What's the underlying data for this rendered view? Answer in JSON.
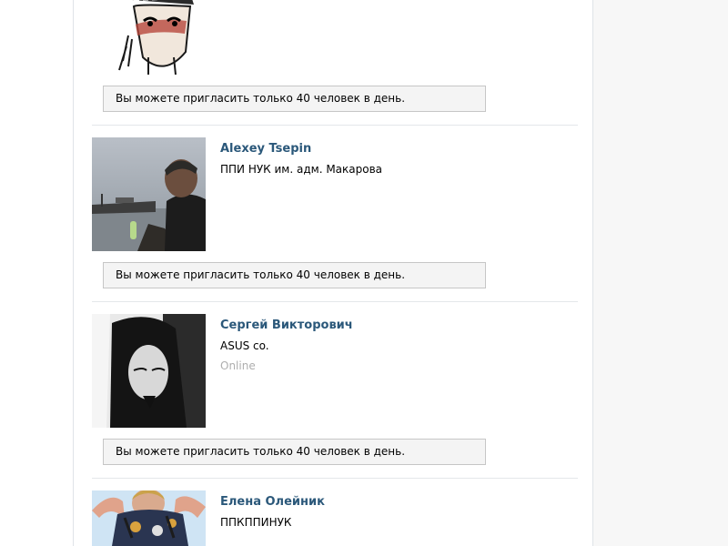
{
  "invite_limit_text": "Вы можете пригласить только 40 человек в день.",
  "people": [
    {
      "name": "",
      "subtitle": "",
      "status": ""
    },
    {
      "name": "Alexey Tsepin",
      "subtitle": "ППИ НУК им. адм. Макарова",
      "status": ""
    },
    {
      "name": "Сергей Викторович",
      "subtitle": "ASUS co.",
      "status": "Online"
    },
    {
      "name": "Елена Олейник",
      "subtitle": "ППКППИНУК",
      "status": ""
    }
  ]
}
